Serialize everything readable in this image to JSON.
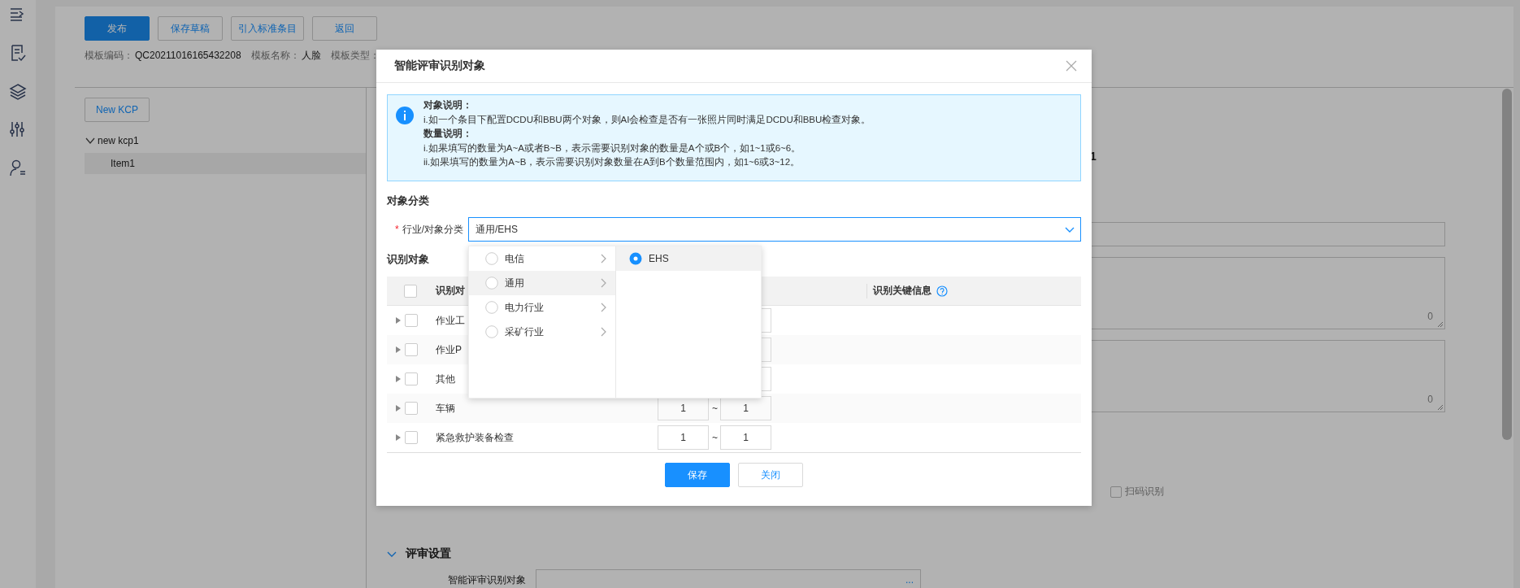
{
  "toolbar": {
    "buttons": [
      {
        "label": "发布",
        "kind": "primary"
      },
      {
        "label": "保存草稿",
        "kind": "default"
      },
      {
        "label": "引入标准条目",
        "kind": "default"
      },
      {
        "label": "返回",
        "kind": "default"
      }
    ]
  },
  "template_info": [
    {
      "label": "模板编码：",
      "value": "QC20211016165432208"
    },
    {
      "label": "模板名称：",
      "value": "人脸"
    },
    {
      "label": "模板类型："
    }
  ],
  "kcp_panel": {
    "new_button": "New KCP",
    "tree": [
      {
        "label": "new kcp1",
        "expanded": true,
        "children": [
          {
            "label": "Item1",
            "selected": true
          }
        ]
      }
    ]
  },
  "form": {
    "fragment": "1",
    "fields": [
      {
        "kind": "input"
      },
      {
        "kind": "textarea",
        "count": "0"
      },
      {
        "kind": "textarea",
        "count": "0"
      }
    ],
    "scan_checkbox": {
      "label": "扫码识别",
      "checked": false
    }
  },
  "review_section": {
    "title": "评审设置",
    "expanded": true,
    "field_label": "智能评审识别对象",
    "field_button": "..."
  },
  "dialog": {
    "title": "智能评审识别对象",
    "notice": [
      {
        "kind": "heading",
        "text": "对象说明："
      },
      {
        "kind": "text",
        "text": "i.如一个条目下配置DCDU和BBU两个对象，则AI会检查是否有一张照片同时满足DCDU和BBU检查对象。"
      },
      {
        "kind": "heading",
        "text": "数量说明："
      },
      {
        "kind": "text",
        "text": "i.如果填写的数量为A~A或者B~B，表示需要识别对象的数量是A个或B个，如1~1或6~6。"
      },
      {
        "kind": "text",
        "text": "ii.如果填写的数量为A~B，表示需要识别对象数量在A到B个数量范围内，如1~6或3~12。"
      }
    ],
    "category_heading": "对象分类",
    "category_field": {
      "required_mark": "*",
      "label": "行业/对象分类",
      "value": "通用/EHS"
    },
    "cascader": {
      "level_1": [
        {
          "label": "电信",
          "selected": false,
          "expanded": false
        },
        {
          "label": "通用",
          "selected": false,
          "expanded": true
        },
        {
          "label": "电力行业",
          "selected": false,
          "expanded": false
        },
        {
          "label": "采矿行业",
          "selected": false,
          "expanded": false
        }
      ],
      "level_2": [
        {
          "label": "EHS",
          "selected": true
        }
      ]
    },
    "objects_heading": "识别对象",
    "table": {
      "header_checked": false,
      "columns": [
        "识别对",
        "识别关键信息"
      ],
      "rows": [
        {
          "name": "作业工",
          "checked": false
        },
        {
          "name": "作业P",
          "checked": false
        },
        {
          "name": "其他",
          "checked": false
        },
        {
          "name": "车辆",
          "checked": false,
          "min": "1",
          "separator": "~",
          "max": "1"
        },
        {
          "name": "紧急救护装备检查",
          "checked": false,
          "min": "1",
          "separator": "~",
          "max": "1"
        }
      ]
    },
    "footer_buttons": [
      {
        "label": "保存",
        "kind": "primary"
      },
      {
        "label": "关闭",
        "kind": "default"
      }
    ]
  }
}
